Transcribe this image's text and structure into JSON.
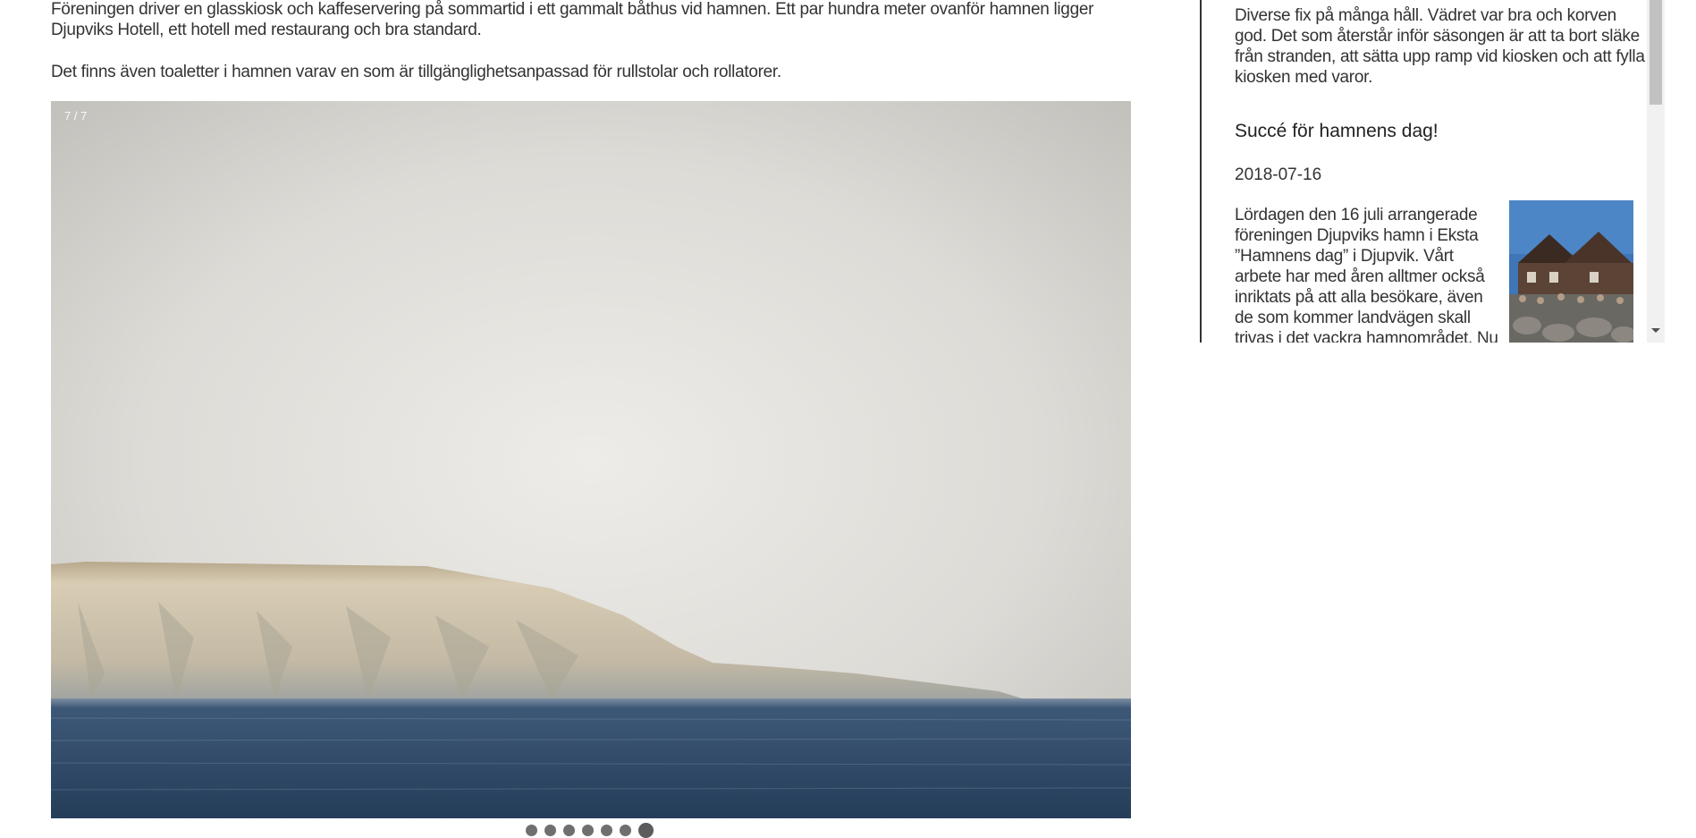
{
  "main": {
    "paragraph1": "Föreningen driver en glasskiosk och kaffeservering på sommartid i ett gammalt båthus vid hamnen. Ett par hundra meter ovanför hamnen ligger Djupviks Hotell, ett hotell med restaurang och bra standard.",
    "paragraph2": "Det finns även toaletter i hamnen varav en som är tillgänglighetsanpassad för rullstolar och rollatorer.",
    "slideshow": {
      "counter": "7 / 7",
      "total": 7,
      "active": 7
    }
  },
  "sidebar": {
    "intro_text": "Diverse fix på många håll. Vädret var bra och korven god. Det som återstår inför säsongen är att ta bort släke från stranden, att sätta upp ramp vid kiosken och att fylla kiosken med varor.",
    "post": {
      "title": "Succé för hamnens dag!",
      "date": "2018-07-16",
      "body": "Lördagen den 16 juli arrangerade föreningen Djupviks hamn i Eksta ”Hamnens dag” i Djupvik. Vårt arbete har med åren alltmer också inriktats på att alla besökare, även de som kommer landvägen skall trivas i det vackra hamnområdet. Nu"
    }
  },
  "colors": {
    "text": "#333333",
    "sky": "#d9d7d2",
    "sea": "#2e4866",
    "cliff": "#c9c0aa"
  }
}
